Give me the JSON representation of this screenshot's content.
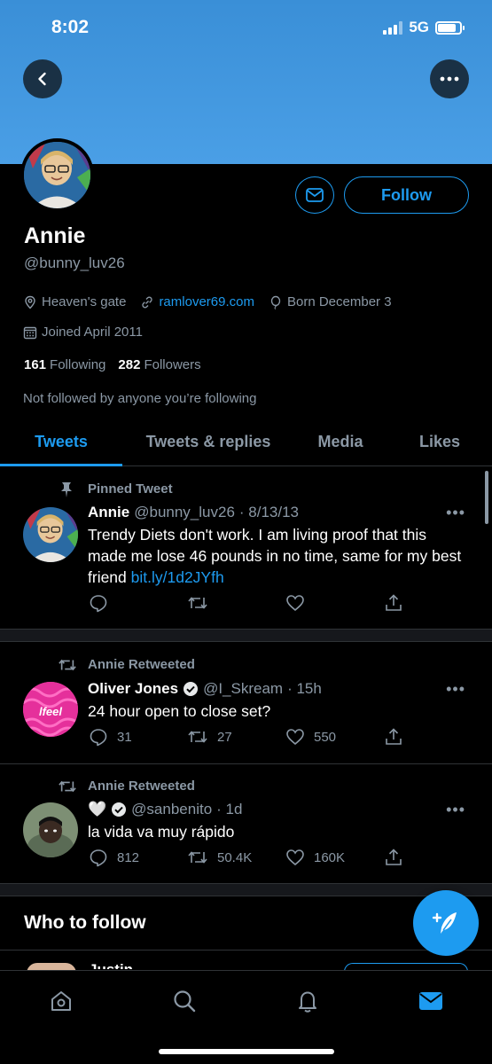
{
  "status_bar": {
    "time": "8:02",
    "network": "5G",
    "battery_level": 0.85
  },
  "colors": {
    "accent": "#1d9bf0",
    "banner": "#4a9fe6",
    "background": "#000000",
    "muted": "#8b98a5"
  },
  "profile": {
    "name": "Annie",
    "handle": "@bunny_luv26",
    "location": "Heaven's gate",
    "website": "ramlover69.com",
    "birthday": "Born December 3",
    "joined": "Joined April 2011",
    "following_count": "161",
    "following_label": "Following",
    "followers_count": "282",
    "followers_label": "Followers",
    "not_followed_text": "Not followed by anyone you’re following",
    "follow_button": "Follow"
  },
  "tabs": [
    {
      "label": "Tweets",
      "active": true
    },
    {
      "label": "Tweets & replies",
      "active": false
    },
    {
      "label": "Media",
      "active": false
    },
    {
      "label": "Likes",
      "active": false
    }
  ],
  "tweets": [
    {
      "context": "Pinned Tweet",
      "context_icon": "pin-icon",
      "author": "Annie",
      "handle": "@bunny_luv26",
      "time": "· 8/13/13",
      "text": "Trendy Diets don't work. I am living proof that this made me lose 46 pounds in no time, same for my best friend ",
      "link": "bit.ly/1d2JYfh",
      "replies": "",
      "retweets": "",
      "likes": ""
    },
    {
      "context": "Annie Retweeted",
      "context_icon": "retweet-icon",
      "author": "Oliver Jones",
      "verified": true,
      "handle": "@I_Skream",
      "time": "· 15h",
      "text": "24 hour open to close set?",
      "avatar_text": "lfeel",
      "replies": "31",
      "retweets": "27",
      "likes": "550"
    },
    {
      "context": "Annie Retweeted",
      "context_icon": "retweet-icon",
      "author": "🤍",
      "verified": true,
      "handle": "@sanbenito",
      "time": "· 1d",
      "text": "la vida va muy rápido",
      "replies": "812",
      "retweets": "50.4K",
      "likes": "160K"
    }
  ],
  "who_to_follow": {
    "title": "Who to follow",
    "peek_name": "Justin"
  },
  "bottom_nav": [
    "home-icon",
    "search-icon",
    "bell-icon",
    "mail-icon"
  ]
}
